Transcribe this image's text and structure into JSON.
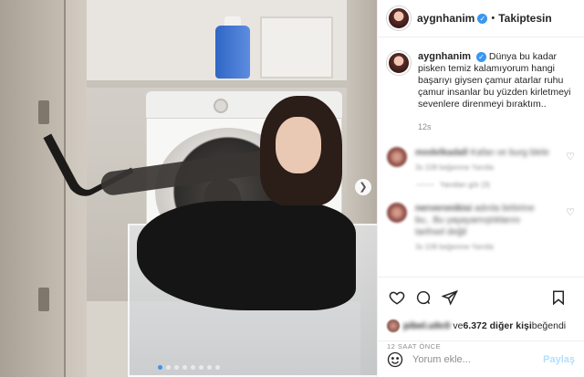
{
  "post": {
    "username": "aygnhanim",
    "follow_status": "Takiptesin",
    "caption": "Dünya bu kadar pisken temiz kalamıyorum hangi başarıyı giysen çamur atarlar ruhu çamur insanlar bu yüzden kirletmeyi sevenlere direnmeyi bıraktım..",
    "caption_time": "12s",
    "carousel": {
      "slides": 8,
      "active_index": 0
    }
  },
  "comments": [
    {
      "username": "modelkadall",
      "text": "Kafan ve burg blele",
      "meta": "3s   108 beğenme   Yanıtla"
    },
    {
      "username": "nerveronikisi",
      "text": "adınla birbirine bu.. Bu yaşayamıştıklarını tarihsel değil",
      "meta": "3s   108 beğenme   Yanıtla"
    }
  ],
  "replies_text": "Yanıtları gör (3)",
  "likes": {
    "blurred_name": "pibel.u0c0",
    "text_mid": " ve ",
    "count_text": "6.372 diğer kişi",
    "text_end": " beğendi"
  },
  "time_ago": "12 SAAT ÖNCE",
  "add_comment": {
    "placeholder": "Yorum ekle...",
    "share_label": "Paylaş"
  },
  "icons": {
    "like": "heart-icon",
    "comment": "comment-icon",
    "share": "paper-plane-icon",
    "save": "bookmark-icon",
    "emoji": "emoji-icon",
    "next": "chevron-right-icon",
    "verified": "verified-badge-icon"
  },
  "colors": {
    "accent": "#3897f0",
    "share_disabled": "#b2dffc",
    "muted": "#8e8e8e"
  }
}
